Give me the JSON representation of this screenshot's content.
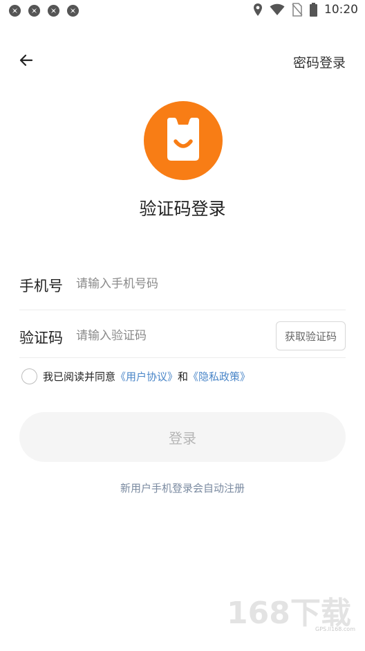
{
  "status_bar": {
    "time": "10:20",
    "notification_icons": [
      "app-notification-icon",
      "app-notification-icon",
      "app-notification-icon",
      "app-notification-icon"
    ],
    "system_icons": [
      "location-icon",
      "wifi-icon",
      "no-sim-icon",
      "battery-icon"
    ]
  },
  "header": {
    "back_icon": "arrow-left-icon",
    "password_login_label": "密码登录"
  },
  "logo": {
    "icon": "app-logo-icon",
    "color": "#f87d15"
  },
  "title": "验证码登录",
  "form": {
    "phone": {
      "label": "手机号",
      "placeholder": "请输入手机号码",
      "value": ""
    },
    "code": {
      "label": "验证码",
      "placeholder": "请输入验证码",
      "value": "",
      "get_code_label": "获取验证码"
    }
  },
  "agreement": {
    "checked": false,
    "prefix": "我已阅读并同意",
    "user_agreement": "《用户协议》",
    "connector": "和",
    "privacy_policy": "《隐私政策》",
    "link_color": "#4a86c8"
  },
  "login_button_label": "登录",
  "hint": "新用户手机登录会自动注册",
  "watermark": {
    "brand": "168下载",
    "url": "GPS.ll168.com"
  }
}
